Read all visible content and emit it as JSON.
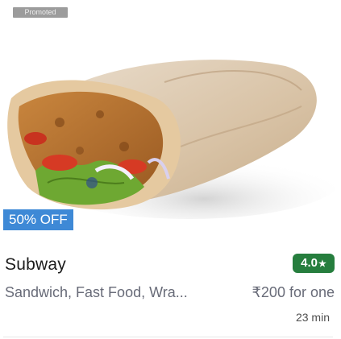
{
  "card": {
    "badge": "Promoted",
    "offer": "50% OFF",
    "restaurant_name": "Subway",
    "rating": "4.0",
    "rating_star": "★",
    "cuisines": "Sandwich, Fast Food, Wra...",
    "price": "₹200 for one",
    "delivery_time": "23 min",
    "image_alt": "wrap-food-image"
  },
  "colors": {
    "offer_bg": "#3e89d6",
    "rating_bg": "#267e3e",
    "badge_bg": "#9c9c9c"
  }
}
